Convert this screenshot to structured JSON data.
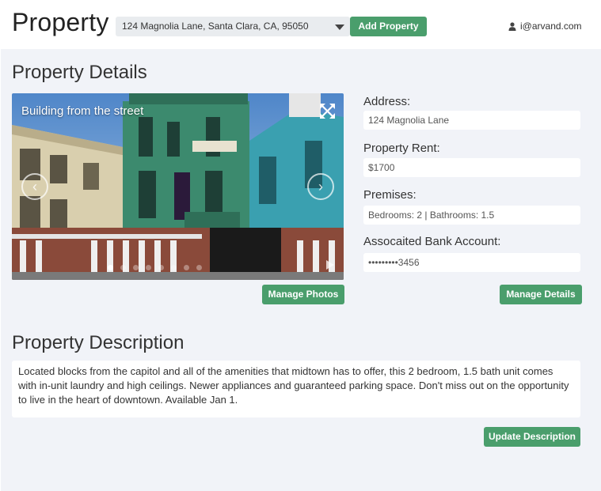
{
  "header": {
    "app_title": "Property",
    "selected_property": "124 Magnolia Lane, Santa Clara, CA, 95050",
    "add_property_label": "Add Property",
    "user_email": "i@arvand.com"
  },
  "details_section": {
    "title": "Property Details",
    "carousel": {
      "caption": "Building from the street",
      "slide_count": 8,
      "active_slide": 1
    },
    "manage_photos_label": "Manage Photos",
    "fields": [
      {
        "label": "Address:",
        "value": "124 Magnolia Lane"
      },
      {
        "label": "Property Rent:",
        "value": "$1700"
      },
      {
        "label": "Premises:",
        "value": "Bedrooms: 2 | Bathrooms: 1.5"
      },
      {
        "label": "Assocaited Bank Account:",
        "value": "•••••••••3456"
      }
    ],
    "manage_details_label": "Manage Details"
  },
  "description_section": {
    "title": "Property Description",
    "text": "Located blocks from the capitol and all of the amenities that midtown has to offer, this 2 bedroom, 1.5 bath unit comes with in-unit laundry and high ceilings. Newer appliances and guaranteed parking space. Don't miss out on the opportunity to live in the heart of downtown. Available Jan 1.",
    "update_label": "Update Description"
  },
  "colors": {
    "accent": "#4a9e6c",
    "panel_background": "#f1f3f8",
    "select_background": "#e9ecef"
  },
  "icons": [
    "user-icon",
    "chevron-down-icon",
    "expand-icon",
    "chevron-left-icon",
    "chevron-right-icon",
    "play-icon"
  ]
}
